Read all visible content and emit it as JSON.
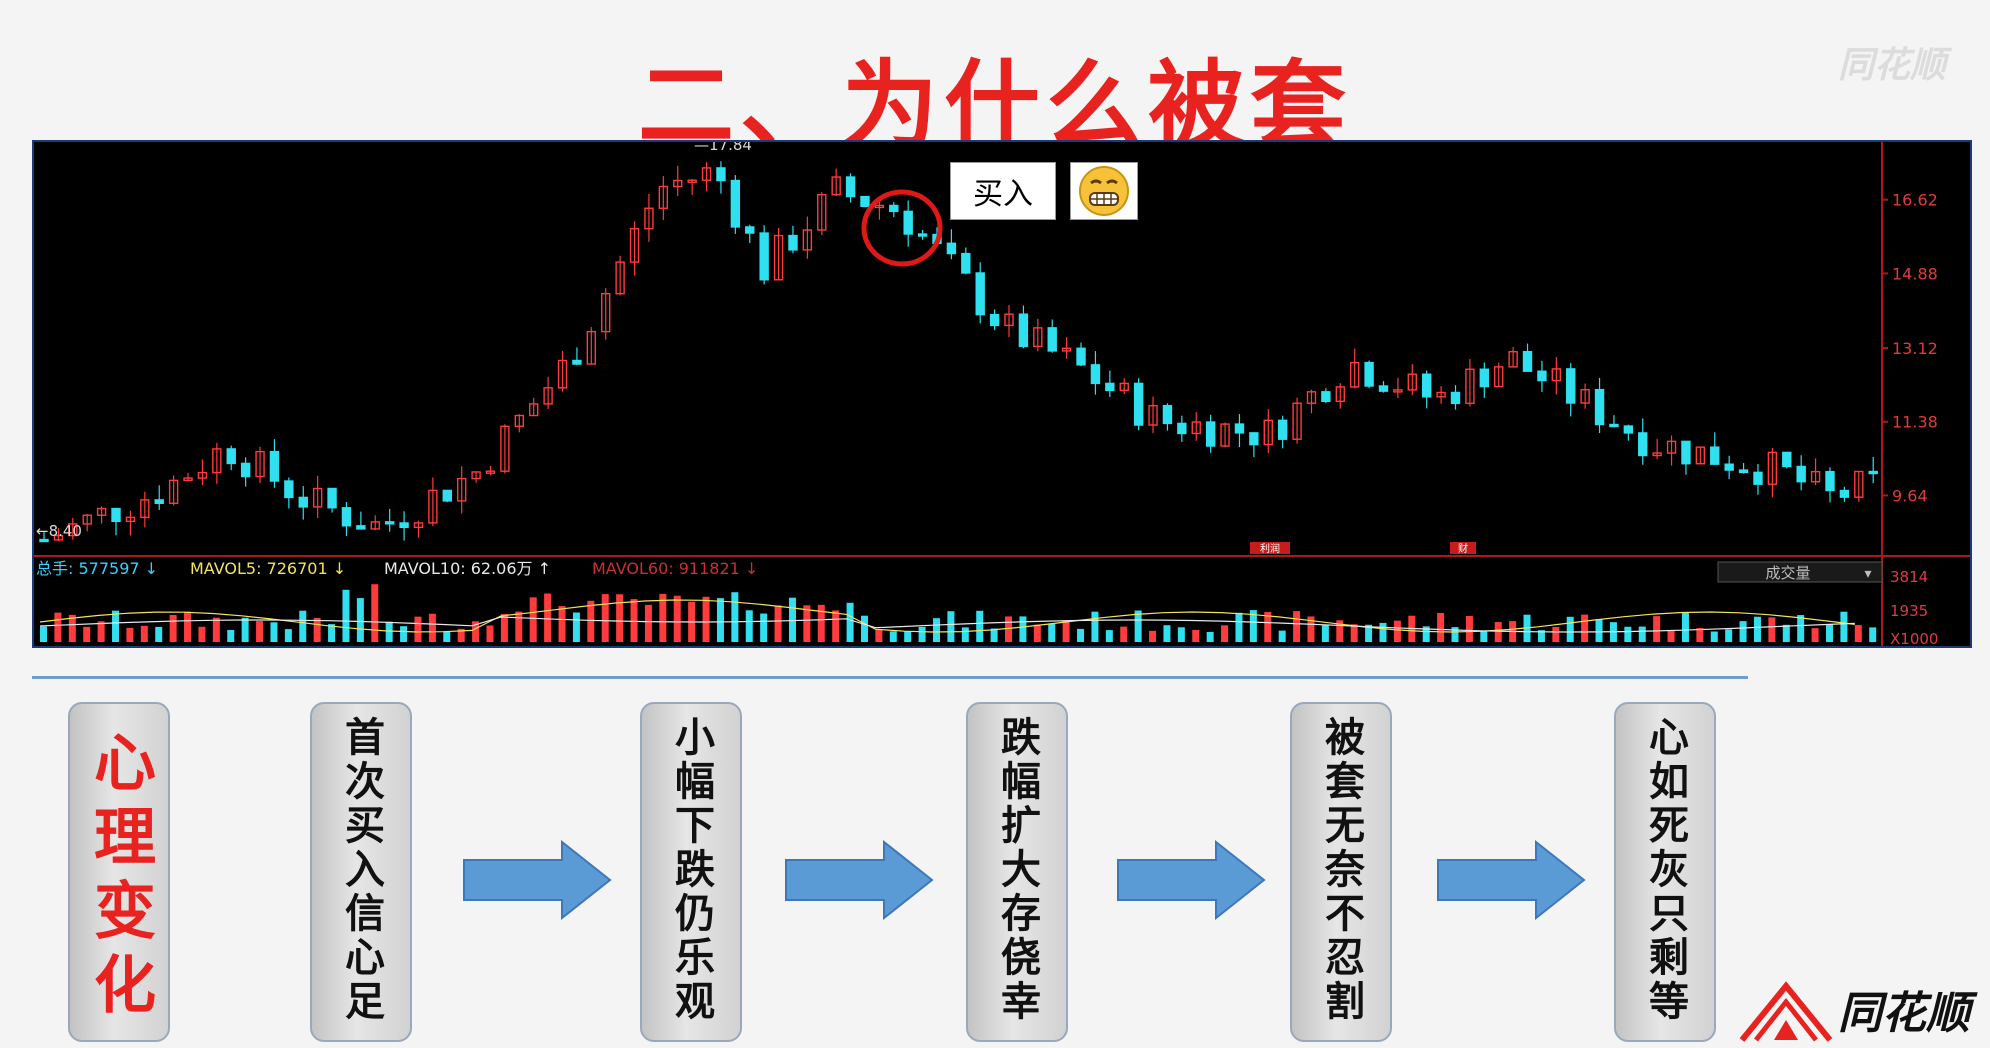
{
  "title": "二、为什么被套",
  "watermark": "同花顺",
  "callout": {
    "text": "买入",
    "emoji": "grimacing-face-icon"
  },
  "chart": {
    "price_labels": [
      "16.62",
      "14.88",
      "13.12",
      "11.38",
      "9.64"
    ],
    "high_label": "17.84",
    "low_label": "8.40",
    "volume_labels": [
      "3814",
      "1935",
      "X1000"
    ],
    "volume_header": {
      "total": "总手: 577597",
      "mavol5": "MAVOL5: 726701",
      "mavol10": "MAVOL10: 62.06万",
      "mavol60": "MAVOL60: 911821"
    },
    "selector": "成交量",
    "markers": [
      "利润",
      "财"
    ],
    "colors": {
      "up": "#ff3b3b",
      "down": "#2fe0f0",
      "bg": "#000000",
      "axis": "#b01818"
    }
  },
  "chart_data": {
    "type": "candlestick",
    "y_max_label": 17.84,
    "y_min_label": 8.4,
    "y_ticks": [
      16.62,
      14.88,
      13.12,
      11.38,
      9.64
    ],
    "volume_ticks": [
      3814,
      1935
    ],
    "volume_unit": "X1000"
  },
  "steps": [
    {
      "text": "心理变化",
      "style": "heading"
    },
    {
      "text": "首次买入信心足"
    },
    {
      "text": "小幅下跌仍乐观"
    },
    {
      "text": "跌幅扩大存侥幸"
    },
    {
      "text": "被套无奈不忍割"
    },
    {
      "text": "心如死灰只剩等"
    }
  ],
  "logo": "同花顺"
}
